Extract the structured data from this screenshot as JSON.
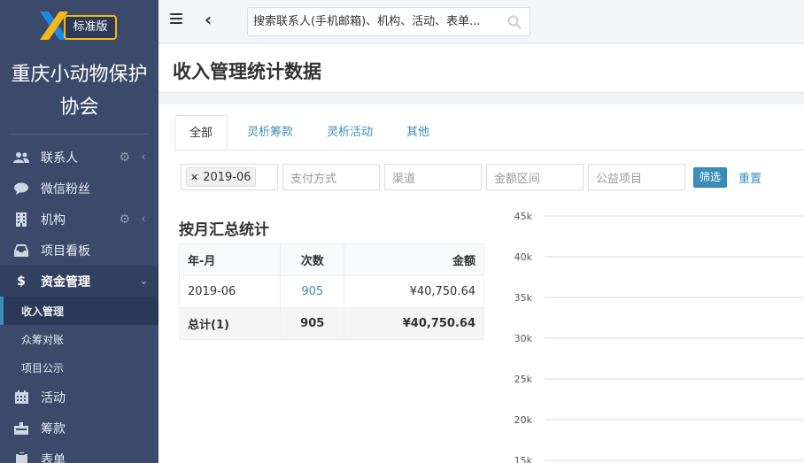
{
  "sidebar": {
    "logo_badge": "标准版",
    "org_name_line1": "重庆小动物保护",
    "org_name_line2": "协会",
    "items": [
      {
        "label": "联系人",
        "icon": "user-group-icon"
      },
      {
        "label": "微信粉丝",
        "icon": "chat-bubble-icon"
      },
      {
        "label": "机构",
        "icon": "building-icon"
      },
      {
        "label": "项目看板",
        "icon": "inbox-icon"
      },
      {
        "label": "资金管理",
        "icon": "dollar-icon"
      },
      {
        "label": "活动",
        "icon": "calendar-icon"
      },
      {
        "label": "筹款",
        "icon": "donation-box-icon"
      },
      {
        "label": "表单",
        "icon": "clipboard-icon"
      }
    ],
    "sub_items": [
      {
        "label": "收入管理"
      },
      {
        "label": "众筹对账"
      },
      {
        "label": "项目公示"
      }
    ]
  },
  "topbar": {
    "search_placeholder": "搜索联系人(手机邮箱)、机构、活动、表单..."
  },
  "page": {
    "title": "收入管理统计数据"
  },
  "tabs": [
    {
      "label": "全部"
    },
    {
      "label": "灵析筹款"
    },
    {
      "label": "灵析活动"
    },
    {
      "label": "其他"
    }
  ],
  "filters": {
    "tag": "2019-06",
    "pay_method": "支付方式",
    "channel": "渠道",
    "amount_range": "金额区间",
    "project": "公益项目",
    "filter_btn": "筛选",
    "reset_btn": "重置"
  },
  "summary": {
    "title": "按月汇总统计",
    "headers": [
      "年-月",
      "次数",
      "金额"
    ],
    "rows": [
      {
        "month": "2019-06",
        "count": "905",
        "amount": "¥40,750.64"
      }
    ],
    "total": {
      "label": "总计(1)",
      "count": "905",
      "amount": "¥40,750.64"
    }
  },
  "chart_data": {
    "type": "bar",
    "y_ticks": [
      "45k",
      "40k",
      "35k",
      "30k",
      "25k",
      "20k",
      "15k"
    ],
    "grid": true
  },
  "colors": {
    "sidebar_bg": "#3b4a6b",
    "accent": "#3c8dbc",
    "logo_orange": "#f5b915",
    "logo_blue": "#1e88e5"
  }
}
